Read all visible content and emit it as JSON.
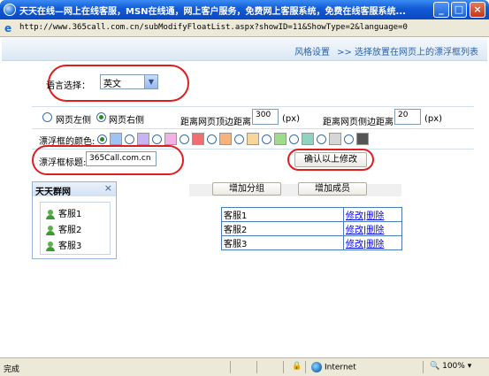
{
  "window": {
    "title": "天天在线—网上在线客服，MSN在线通，网上客户服务，免费网上客服系统，免费在线客服系统...",
    "minimize_label": "_",
    "maximize_label": "□",
    "close_label": "×"
  },
  "address": {
    "url": "http://www.365call.com.cn/subModifyFloatList.aspx?showID=11&ShowType=2&language=0"
  },
  "breadcrumb": {
    "section": "风格设置",
    "page": ">> 选择放置在网页上的漂浮框列表"
  },
  "language": {
    "label": "语言选择：",
    "selected": "英文"
  },
  "position": {
    "left_label": "网页左侧",
    "right_label": "网页右侧",
    "selected": "right",
    "top_label": "距离网页顶边距离:",
    "top_value": "300",
    "top_unit": "(px)",
    "side_label": "距离网页侧边距离:",
    "side_value": "20",
    "side_unit": "(px)"
  },
  "colors": {
    "label": "漂浮框的颜色:",
    "swatches": [
      "#9ec3f5",
      "#c9b3f2",
      "#f3b2e6",
      "#f06e6e",
      "#f7b27a",
      "#f8d69a",
      "#9ddc8b",
      "#8ed4c1",
      "#d6d6d6",
      "#555555"
    ],
    "selected_index": 0
  },
  "title_field": {
    "label": "漂浮框标题:",
    "value": "365Call.com.cn"
  },
  "confirm_button": "确认以上修改",
  "panel": {
    "title": "天天群网",
    "close": "×",
    "members": [
      "客服1",
      "客服2",
      "客服3"
    ]
  },
  "toolbar": {
    "add_group": "增加分组",
    "add_member": "增加成员"
  },
  "member_table": {
    "rows": [
      {
        "name": "客服1",
        "edit": "修改",
        "delete": "删除"
      },
      {
        "name": "客服2",
        "edit": "修改",
        "delete": "删除"
      },
      {
        "name": "客服3",
        "edit": "修改",
        "delete": "删除"
      }
    ],
    "divider": "|"
  },
  "status": {
    "text": "完成",
    "zone": "Internet",
    "zoom": "100%"
  }
}
